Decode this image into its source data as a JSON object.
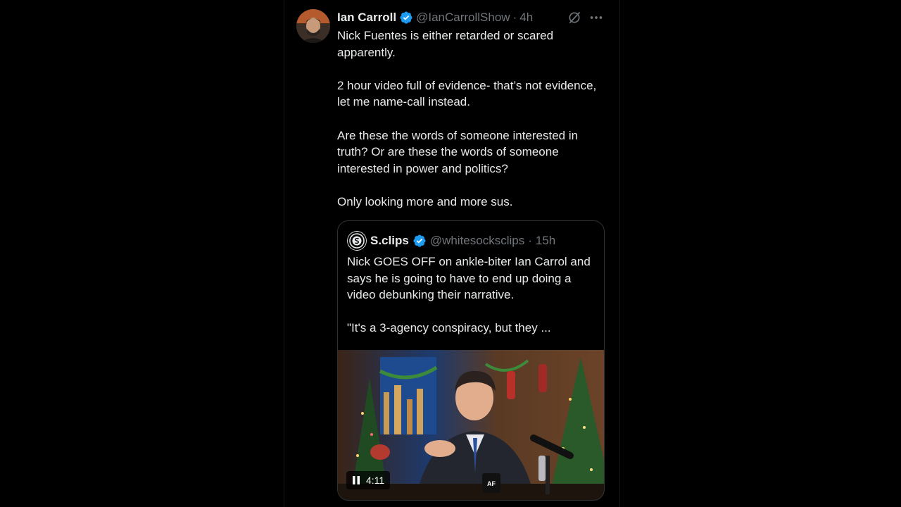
{
  "tweet": {
    "author_name": "Ian Carroll",
    "handle": "@IanCarrollShow",
    "separator": "·",
    "time": "4h",
    "paragraphs": [
      "Nick Fuentes is either retarded or scared apparently.",
      "2 hour video full of evidence- that’s not evidence, let me name-call instead.",
      "Are these the words of someone interested in truth? Or are these the words of someone interested in power and politics?",
      "Only looking more and more sus."
    ]
  },
  "quoted": {
    "author_name": "S.clips",
    "handle": "@whitesocksclips",
    "separator": "·",
    "time": "15h",
    "paragraphs": [
      "Nick GOES OFF on ankle-biter Ian Carrol and says he is going to have to end up doing a video debunking their narrative.",
      "\"It's a 3-agency conspiracy, but they ..."
    ],
    "video": {
      "duration": "4:11",
      "mug_logo": "AF"
    }
  },
  "icons": {
    "verified": "verified-badge-icon",
    "grok": "grok-icon",
    "more": "more-icon",
    "pause": "pause-icon"
  },
  "colors": {
    "background": "#000000",
    "text": "#e7e9ea",
    "secondary_text": "#71767b",
    "verified_blue": "#1d9bf0",
    "border": "#2f3336"
  }
}
